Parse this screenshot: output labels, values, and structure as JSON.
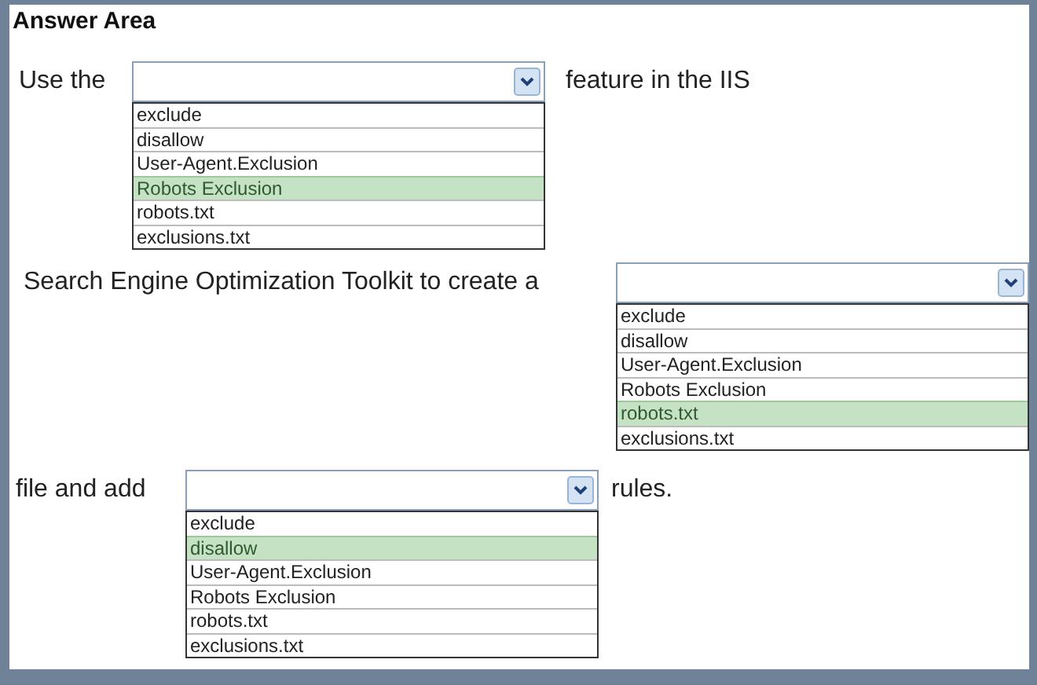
{
  "title": "Answer Area",
  "rows": [
    {
      "before": "Use the",
      "after": "feature in the IIS",
      "options": [
        {
          "label": "exclude",
          "selected": false
        },
        {
          "label": "disallow",
          "selected": false
        },
        {
          "label": "User-Agent.Exclusion",
          "selected": false
        },
        {
          "label": "Robots Exclusion",
          "selected": true
        },
        {
          "label": "robots.txt",
          "selected": false
        },
        {
          "label": "exclusions.txt",
          "selected": false
        }
      ]
    },
    {
      "before": "Search Engine Optimization Toolkit to create a",
      "options": [
        {
          "label": "exclude",
          "selected": false
        },
        {
          "label": "disallow",
          "selected": false
        },
        {
          "label": "User-Agent.Exclusion",
          "selected": false
        },
        {
          "label": "Robots Exclusion",
          "selected": false
        },
        {
          "label": "robots.txt",
          "selected": true
        },
        {
          "label": "exclusions.txt",
          "selected": false
        }
      ]
    },
    {
      "before": "file and add",
      "after": "rules.",
      "options": [
        {
          "label": "exclude",
          "selected": false
        },
        {
          "label": "disallow",
          "selected": true
        },
        {
          "label": "User-Agent.Exclusion",
          "selected": false
        },
        {
          "label": "Robots Exclusion",
          "selected": false
        },
        {
          "label": "robots.txt",
          "selected": false
        },
        {
          "label": "exclusions.txt",
          "selected": false
        }
      ]
    }
  ]
}
